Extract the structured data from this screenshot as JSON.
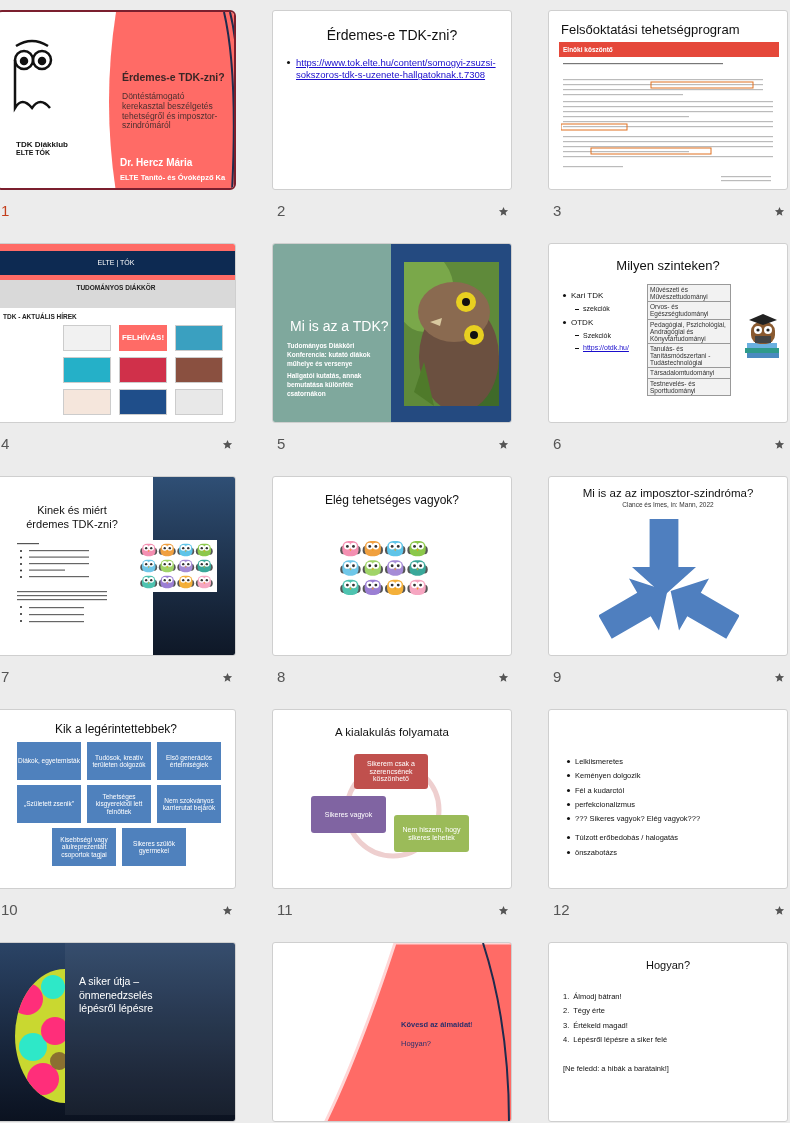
{
  "slides": [
    {
      "kind": "cover",
      "number": "1",
      "selected": true,
      "starred": false,
      "logo_title": "TDK Diákklub",
      "logo_subtitle": "ELTE TÓK",
      "title": "Érdemes-e TDK-zni?",
      "subtitle": "Döntéstámogató kerekasztal beszélgetés tehetségről és imposztor-szindrómáról",
      "author": "Dr. Hercz Mária",
      "affiliation": "ELTE Tanító- és Óvóképző Ka"
    },
    {
      "kind": "links",
      "number": "2",
      "selected": false,
      "starred": true,
      "title": "Érdemes-e TDK-zni?",
      "links": [
        "https://www.tok.elte.hu/content/somogyi-zsuzsi-sokszoros-tdk-s-uzenete-hallgatoknak.t.7308"
      ]
    },
    {
      "kind": "document",
      "number": "3",
      "selected": false,
      "starred": true,
      "title": "Felsőoktatási tehetségprogram",
      "header": "Elnöki köszöntő"
    },
    {
      "kind": "website",
      "number": "4",
      "selected": false,
      "starred": true,
      "logo": "ELTE | TÓK",
      "heading": "TUDOMÁNYOS DIÁKKÖR",
      "section": "TDK - AKTUÁLIS HÍREK",
      "banner": "FELHÍVÁS!"
    },
    {
      "number": "5",
      "selected": false,
      "starred": true,
      "title": "Mi is az a TDK?",
      "lines": [
        "Tudományos Diákköri Konferencia: kutató diákok műhelye és versenye",
        "Hallgatói kutatás, annak bemutatása különféle csatornákon"
      ]
    },
    {
      "kind": "levels",
      "number": "6",
      "selected": false,
      "starred": true,
      "title": "Milyen szinteken?",
      "bullets": [
        {
          "text": "Kari TDK",
          "children": [
            {
              "text": "szekciók",
              "kind": "text"
            }
          ]
        },
        {
          "text": "OTDK",
          "children": [
            {
              "text": "Szekciók",
              "kind": "text"
            },
            {
              "text": "https://otdk.hu/",
              "kind": "link"
            }
          ]
        }
      ],
      "sections": [
        "Művészeti és Művészettudományi",
        "Orvos- és Egészségtudományi",
        "Pedagógiai, Pszichológiai, Andragógiai és Könyvtártudományi",
        "Tanulás- és Tanításmódszertani - Tudástechnológiai",
        "Társadalomtudományi",
        "Testnevelés- és Sporttudományi"
      ]
    },
    {
      "kind": "split",
      "number": "7",
      "selected": false,
      "starred": true,
      "title": "Kinek és miért érdemes TDK-zni?"
    },
    {
      "kind": "owls",
      "number": "8",
      "selected": false,
      "starred": true,
      "title": "Elég tehetséges vagyok?"
    },
    {
      "kind": "arrows",
      "number": "9",
      "selected": false,
      "starred": true,
      "title": "Mi is az az imposztor-szindróma?",
      "subtitle": "Clance és Imes, in: Mann, 2022"
    },
    {
      "kind": "boxes",
      "number": "10",
      "selected": false,
      "starred": true,
      "title": "Kik a legérintettebbek?",
      "boxes": [
        "Diákok, egyetemisták",
        "Tudósok, kreatív területen dolgozók",
        "Első generációs értelmiségiek",
        "„Született zsenik”",
        "Tehetséges kisgyerekből lett felnőttek",
        "Nem szokványos karrierutat bejárók",
        "Kisebbségi vagy alulreprezentált csoportok tagjai",
        "Sikeres szülők gyermekei"
      ]
    },
    {
      "kind": "cycle",
      "number": "11",
      "selected": false,
      "starred": true,
      "title": "A kialakulás folyamata",
      "steps": [
        {
          "text": "Sikerem csak a szerencsének köszönhető",
          "color": "#c0504d"
        },
        {
          "text": "Nem hiszem, hogy sikeres lehetek",
          "color": "#9bbb59"
        },
        {
          "text": "Sikeres vagyok",
          "color": "#8064a2"
        }
      ]
    },
    {
      "kind": "bullets",
      "number": "12",
      "selected": false,
      "starred": true,
      "groups": [
        [
          "Lelkiismeretes",
          "Keményen dolgozik",
          "Fél a kudarctól",
          "perfekcionalizmus",
          "??? Sikeres vagyok? Elég vagyok???"
        ],
        [
          "Túlzott erőbedobás / halogatás",
          "önszabotázs"
        ]
      ]
    },
    {
      "kind": "dark",
      "selected": false,
      "title": "A siker útja – önmenedzselés lépésről lépésre"
    },
    {
      "kind": "coral",
      "selected": false,
      "lines": [
        "**Kövesd az álmaidat**!",
        "Hogyan?"
      ]
    },
    {
      "kind": "numbered",
      "selected": false,
      "title": "Hogyan?",
      "items": [
        {
          "number": "1.",
          "text": "Álmodj bátran!"
        },
        {
          "number": "2.",
          "text": "Tégy érte"
        },
        {
          "number": "3.",
          "text": "Értékeld magad!"
        },
        {
          "number": "4.",
          "text": "Lépésről lépésre a siker felé"
        }
      ],
      "note": "[Ne feledd: a hibák a barátaink!]"
    }
  ]
}
